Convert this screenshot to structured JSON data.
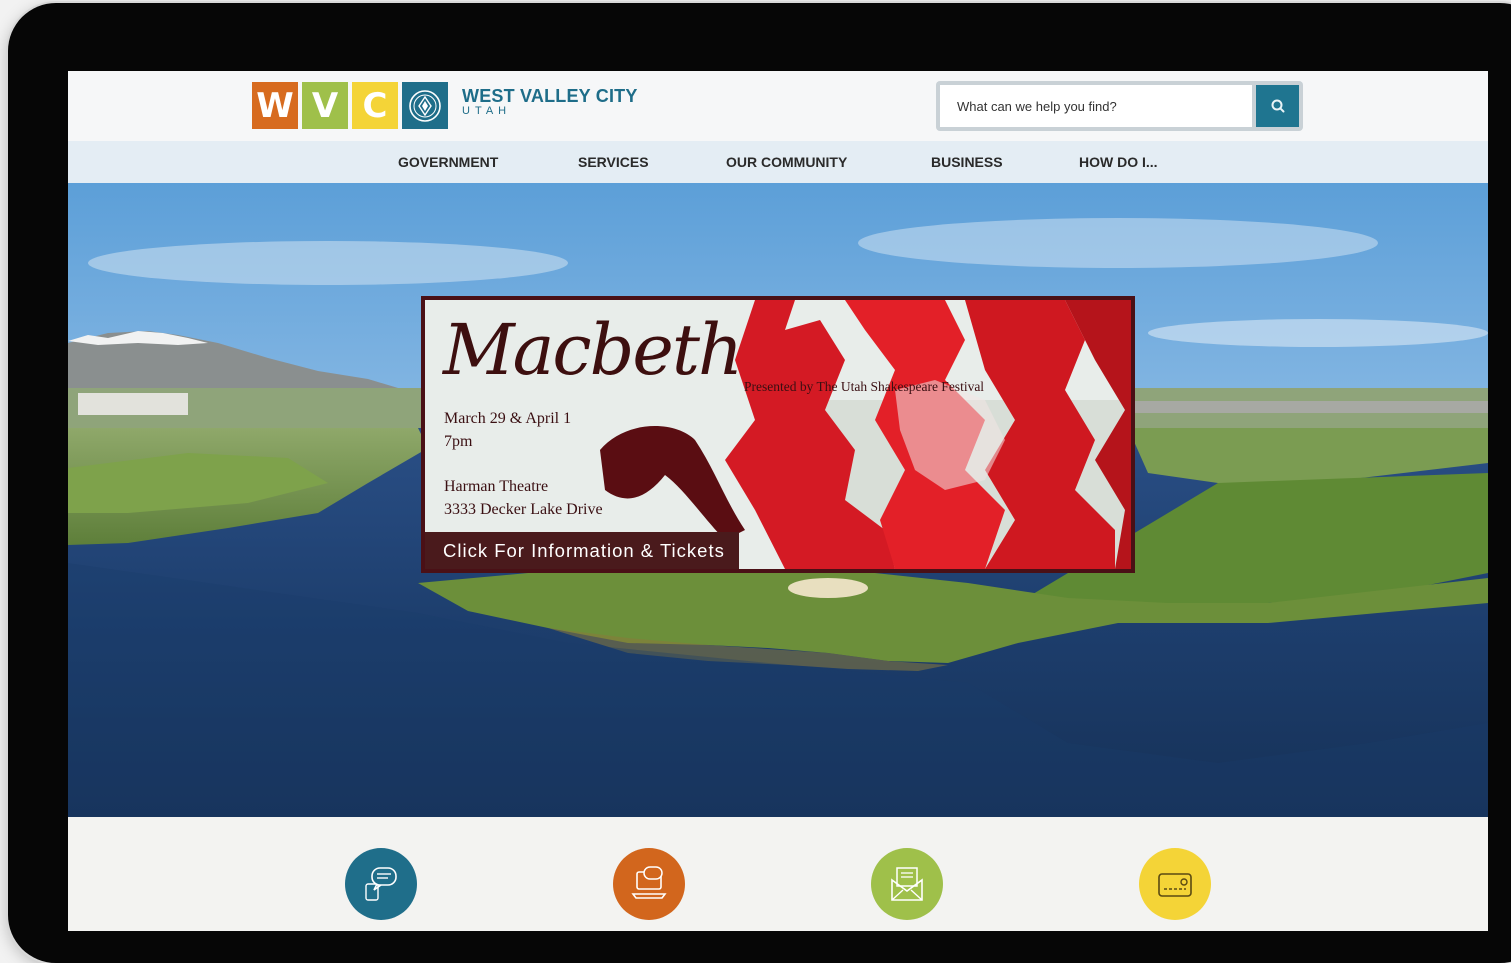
{
  "logo": {
    "letters": [
      "W",
      "V",
      "C"
    ],
    "city_name": "WEST VALLEY CITY",
    "state": "UTAH",
    "seal_icon": "city-seal-icon"
  },
  "search": {
    "placeholder": "What can we help you find?",
    "button_icon": "search-icon"
  },
  "nav": {
    "items": [
      "GOVERNMENT",
      "SERVICES",
      "OUR COMMUNITY",
      "BUSINESS",
      "HOW DO I..."
    ]
  },
  "banner": {
    "title": "Macbeth",
    "presenter": "Presented by The Utah Shakespeare Festival",
    "date": "March 29 & April 1",
    "time": "7pm",
    "venue": "Harman Theatre",
    "address": "3333 Decker Lake Drive",
    "cta": "Click For Information & Tickets"
  },
  "quick_links": [
    {
      "icon": "chat-bubbles-icon",
      "color": "#1f6e8a"
    },
    {
      "icon": "laptop-chat-icon",
      "color": "#d2661d"
    },
    {
      "icon": "envelope-icon",
      "color": "#9fc04a"
    },
    {
      "icon": "payment-card-icon",
      "color": "#f4d437"
    }
  ],
  "colors": {
    "brand_blue": "#1e6d89",
    "brand_orange": "#d76b1f",
    "brand_green": "#9fc04a",
    "brand_yellow": "#f4d437",
    "banner_maroon": "#4a1016"
  }
}
